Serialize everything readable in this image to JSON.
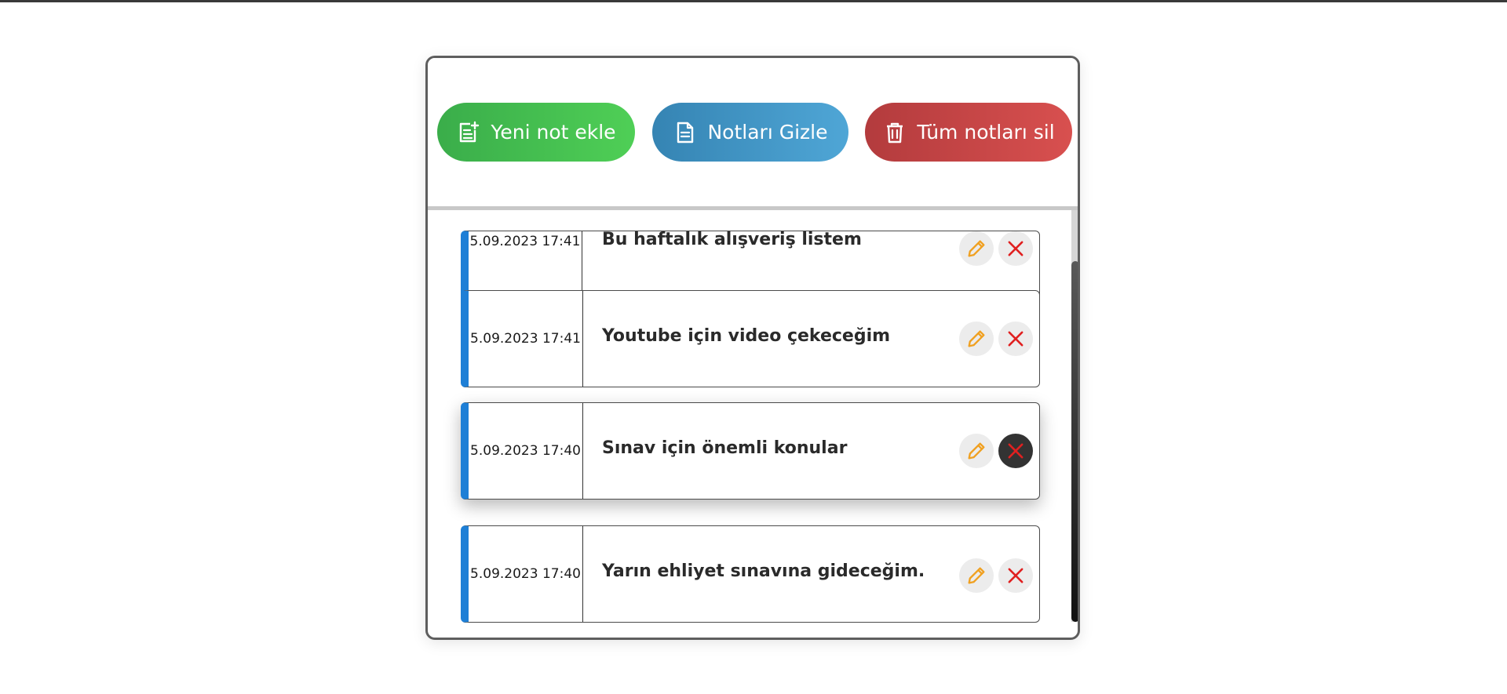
{
  "toolbar": {
    "add_label": "Yeni not ekle",
    "hide_label": "Notları Gizle",
    "clear_label": "Tüm notları sil"
  },
  "notes": [
    {
      "date": "5.09.2023 17:41",
      "text": "Bu haftalık alışveriş listem"
    },
    {
      "date": "5.09.2023 17:41",
      "text": "Youtube için video çekeceğim"
    },
    {
      "date": "5.09.2023 17:40",
      "text": "Sınav için önemli konular"
    },
    {
      "date": "5.09.2023 17:40",
      "text": "Yarın ehliyet sınavına gideceğim."
    }
  ],
  "colors": {
    "add_button": "#3fbf4e",
    "hide_button": "#3f94c5",
    "clear_button": "#c64446",
    "note_accent": "#1e7fd6",
    "edit_icon": "#f0a020",
    "delete_icon": "#e02020"
  },
  "icons": {
    "add": "note-add-icon",
    "hide": "document-icon",
    "clear": "trash-icon",
    "edit": "pencil-icon",
    "delete": "close-icon"
  }
}
